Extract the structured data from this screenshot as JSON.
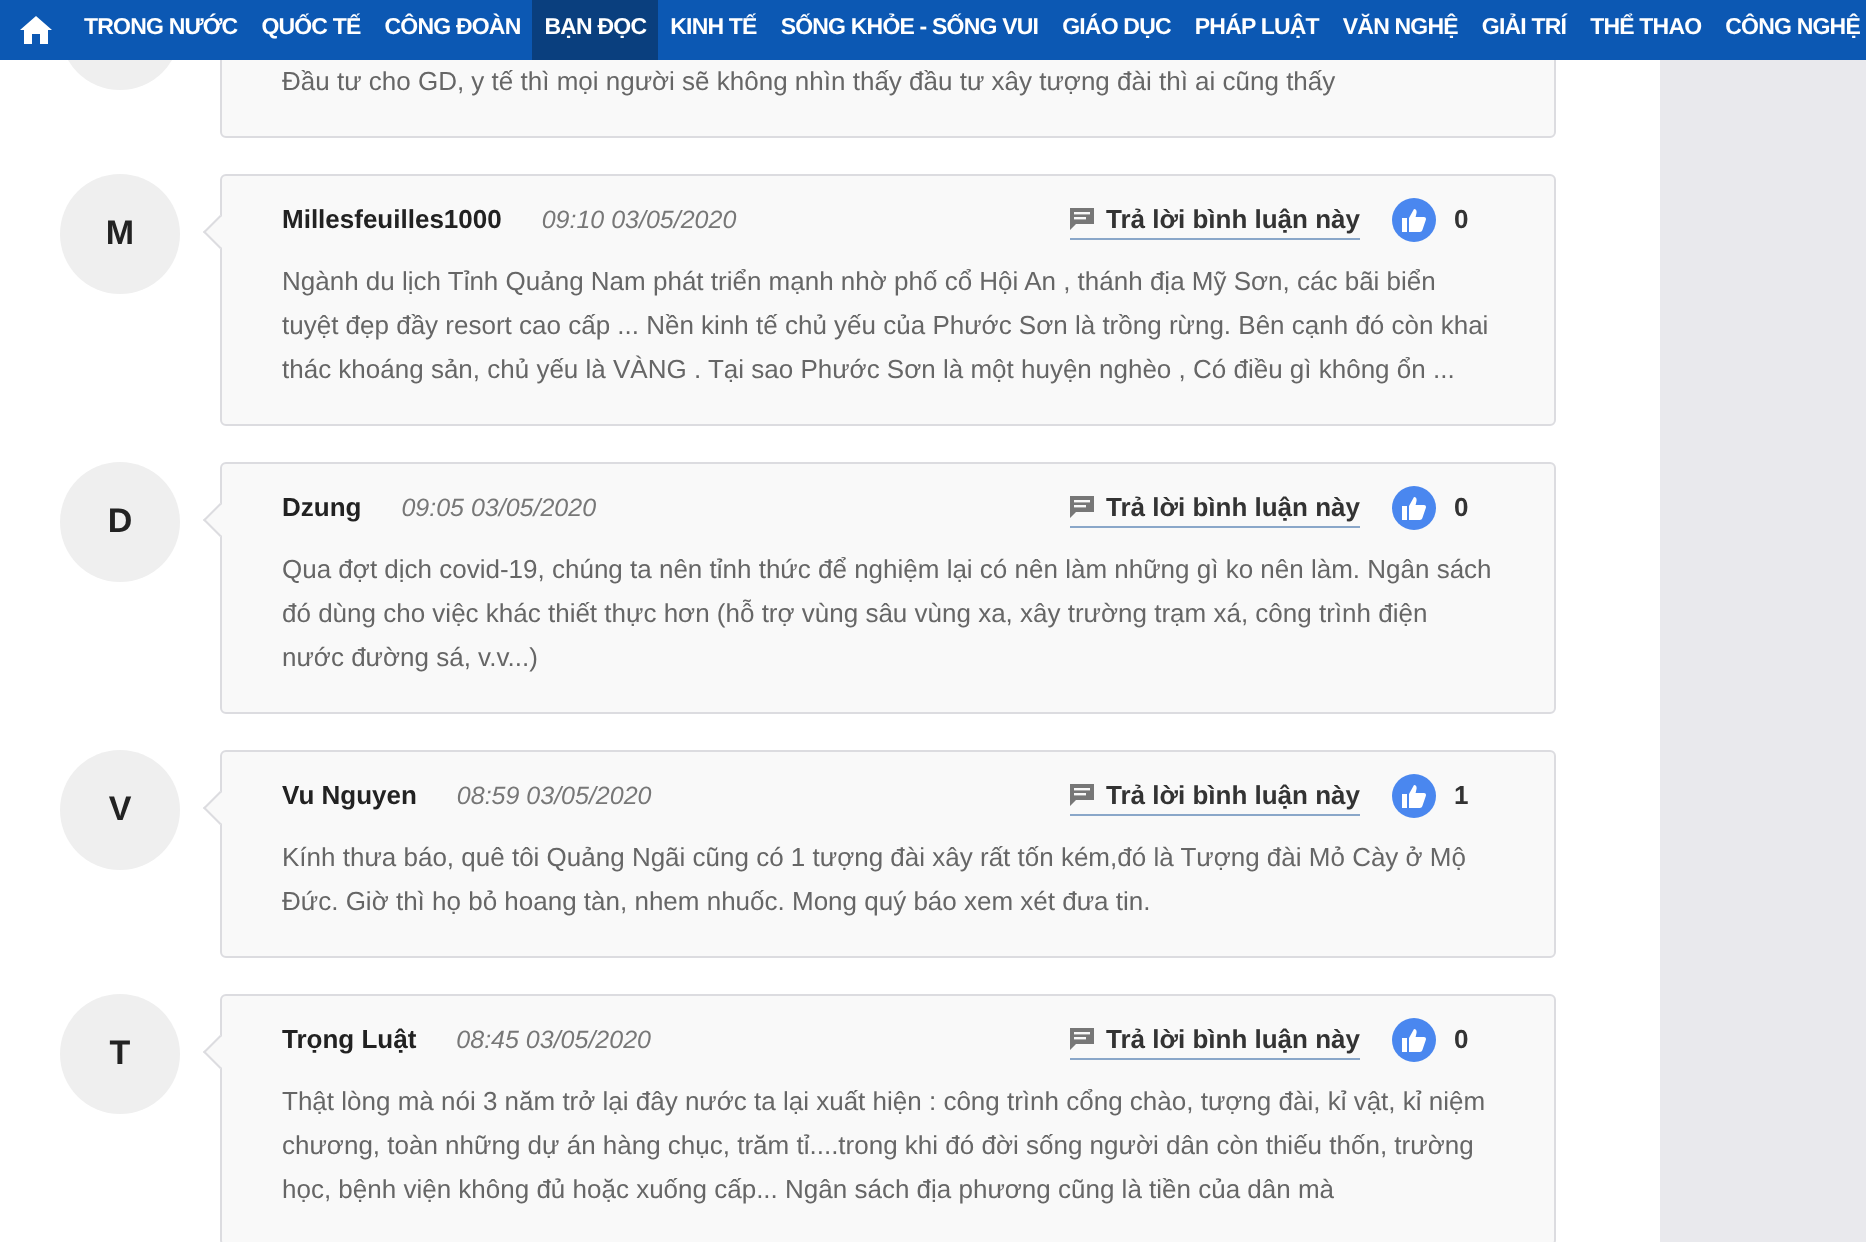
{
  "nav": [
    {
      "label": "TRONG NƯỚC",
      "selected": false
    },
    {
      "label": "QUỐC TẾ",
      "selected": false
    },
    {
      "label": "CÔNG ĐOÀN",
      "selected": false
    },
    {
      "label": "BẠN ĐỌC",
      "selected": true
    },
    {
      "label": "KINH TẾ",
      "selected": false
    },
    {
      "label": "SỐNG KHỎE - SỐNG VUI",
      "selected": false
    },
    {
      "label": "GIÁO DỤC",
      "selected": false
    },
    {
      "label": "PHÁP LUẬT",
      "selected": false
    },
    {
      "label": "VĂN NGHỆ",
      "selected": false
    },
    {
      "label": "GIẢI TRÍ",
      "selected": false
    },
    {
      "label": "THỂ THAO",
      "selected": false
    },
    {
      "label": "CÔNG NGHỆ",
      "selected": false
    }
  ],
  "comments": [
    {
      "text": "Đầu tư cho GD, y tế thì mọi người sẽ không nhìn thấy đầu tư xây tượng đài thì ai cũng thấy"
    },
    {
      "initial": "M",
      "author": "Millesfeuilles1000",
      "time": "09:10 03/05/2020",
      "reply": "Trả lời bình luận này",
      "likes": "0",
      "text": "Ngành du lịch Tỉnh Quảng Nam phát triển mạnh nhờ phố cổ Hội An , thánh địa Mỹ Sơn, các bãi biển tuyệt đẹp đầy resort cao cấp ... Nền kinh tế chủ yếu của Phước Sơn là trồng rừng. Bên cạnh đó còn khai thác khoáng sản, chủ yếu là VÀNG . Tại sao Phước Sơn là một huyện nghèo , Có điều gì không ổn ..."
    },
    {
      "initial": "D",
      "author": "Dzung",
      "time": "09:05 03/05/2020",
      "reply": "Trả lời bình luận này",
      "likes": "0",
      "text": "Qua đợt dịch covid-19, chúng ta nên tỉnh thức để nghiệm lại có nên làm những gì ko nên làm. Ngân sách đó dùng cho việc khác thiết thực hơn (hỗ trợ vùng sâu vùng xa, xây trường trạm xá, công trình điện nước đường sá, v.v...)"
    },
    {
      "initial": "V",
      "author": "Vu Nguyen",
      "time": "08:59 03/05/2020",
      "reply": "Trả lời bình luận này",
      "likes": "1",
      "text": "Kính thưa báo, quê tôi Quảng Ngãi cũng có 1 tượng đài xây rất tốn kém,đó là Tượng đài Mỏ Cày ở Mộ Đức. Giờ thì họ bỏ hoang tàn, nhem nhuốc. Mong quý báo xem xét đưa tin."
    },
    {
      "initial": "T",
      "author": "Trọng Luật",
      "time": "08:45 03/05/2020",
      "reply": "Trả lời bình luận này",
      "likes": "0",
      "text": "Thật lòng mà nói 3 năm trở lại đây nước ta lại xuất hiện : công trình cổng chào, tượng đài, kỉ vật, kỉ niệm chương, toàn những dự án hàng chục, trăm tỉ....trong khi đó đời sống người dân còn thiếu thốn, trường học, bệnh viện không đủ hoặc xuống cấp... Ngân sách địa phương cũng là tiền của dân mà"
    }
  ]
}
